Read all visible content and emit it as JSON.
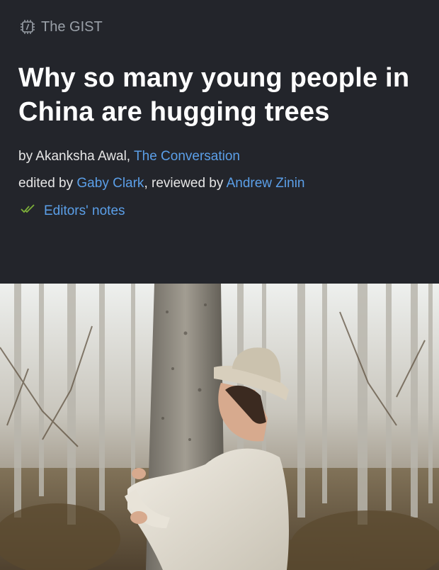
{
  "brand": {
    "label": "The GIST",
    "icon": "chip-icon"
  },
  "article": {
    "title": "Why so many young people in China are hugging trees",
    "byline": {
      "prefix": "by Akanksha Awal, ",
      "source": "The Conversation"
    },
    "edits": {
      "edited_prefix": "edited by ",
      "editor": "Gaby Clark",
      "reviewed_prefix": ", reviewed by ",
      "reviewer": "Andrew Zinin"
    },
    "editors_notes": {
      "label": "Editors' notes",
      "icon": "double-check-icon"
    }
  },
  "hero_image": {
    "subject": "man in hat hugging a tree in a birch forest"
  },
  "colors": {
    "background": "#23252b",
    "link": "#5b9fe8",
    "muted": "#9aa0a8",
    "check": "#7cae3a"
  }
}
